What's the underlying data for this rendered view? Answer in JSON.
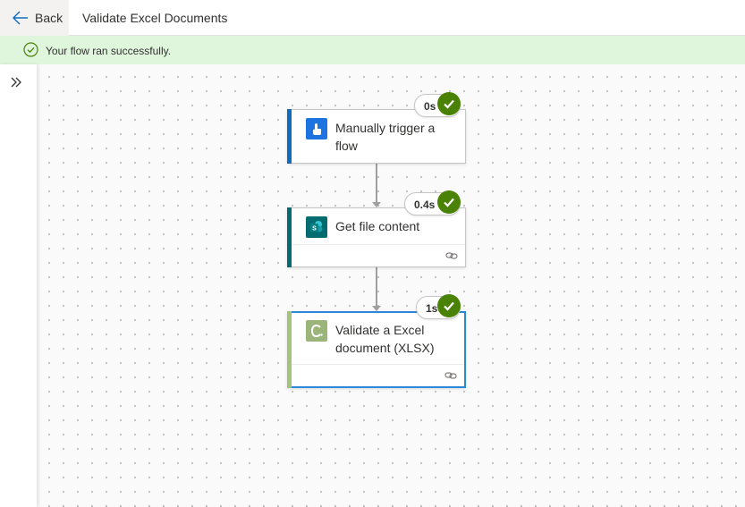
{
  "header": {
    "back_label": "Back",
    "title": "Validate Excel Documents"
  },
  "banner": {
    "message": "Your flow ran successfully."
  },
  "colors": {
    "success_banner": "#dff6dd",
    "success_check": "#498205",
    "trigger_accent": "#0f6cbd",
    "sharepoint_accent": "#036c70",
    "connector_accent": "#a4c17d",
    "selected_border": "#2b88d8"
  },
  "steps": [
    {
      "name": "Manually trigger a flow",
      "duration": "0s",
      "status": "succeeded",
      "icon": "touch-trigger-icon"
    },
    {
      "name": "Get file content",
      "duration": "0.4s",
      "status": "succeeded",
      "icon": "sharepoint-icon"
    },
    {
      "name": "Validate a Excel document (XLSX)",
      "duration": "1s",
      "status": "succeeded",
      "icon": "connector-c-icon"
    }
  ]
}
